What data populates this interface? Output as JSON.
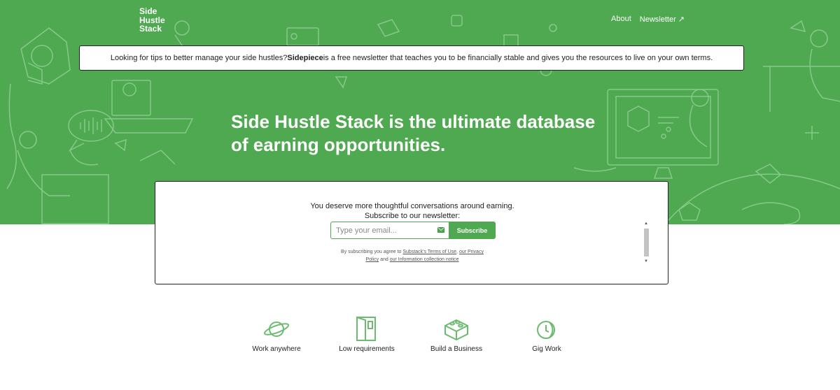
{
  "header": {
    "logo_lines": [
      "Side",
      "Hustle",
      "Stack"
    ],
    "nav": [
      "About",
      "Newsletter ↗"
    ]
  },
  "banner": {
    "text_before": "Looking for tips to better manage your side hustles? ",
    "brand": "Sidepiece",
    "text_after": " is a free newsletter that teaches you to be financially stable and gives you the resources to live on your own terms."
  },
  "hero": {
    "headline_line1": "Side Hustle Stack is the ultimate database",
    "headline_line2": "of earning opportunities."
  },
  "subscribe": {
    "line1": "You deserve more thoughtful conversations around earning.",
    "line2": "Subscribe to our newsletter:",
    "email_placeholder": "Type your email...",
    "button": "Subscribe",
    "legal_prefix": "By subscribing you agree to ",
    "legal_link1": "Substack's Terms of Use",
    "legal_sep": ", ",
    "legal_link2": "our Privacy",
    "legal_link2b": "Policy",
    "legal_and": " and ",
    "legal_link3": "our Information collection notice"
  },
  "features": [
    {
      "label": "Work anywhere",
      "icon": "planet-icon"
    },
    {
      "label": "Low requirements",
      "icon": "door-icon"
    },
    {
      "label": "Build a Business",
      "icon": "brick-icon"
    },
    {
      "label": "Gig Work",
      "icon": "coin-clock-icon"
    }
  ],
  "colors": {
    "brand_green": "#4ea950",
    "line_art": "#7fc482"
  }
}
